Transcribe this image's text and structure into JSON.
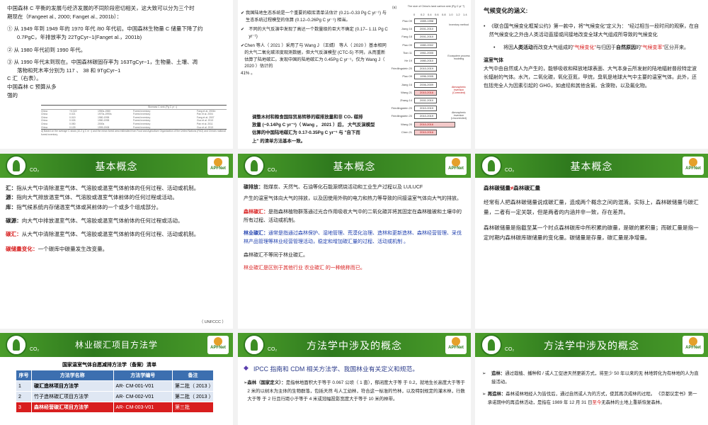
{
  "slide1": {
    "lines": [
      "中国森林 C 平衡的发展与经济发展的不同阶段密切相关，这大致可以分为三个时",
      "期现在（Fangeet al., 2000; Fanget al., 2001b）：",
      "①  从 1949 年到 1949 年的 1970 年代 /80 年代初。中国森林生物量 C 储量下降了约",
      "0.7PgC，年排放率为 22TgCyr−1(Fanget al.，2001b)",
      "②  从 1980 年代初到 1990 年代。",
      "③  从 1990 年代末到现在。中国森林碳固存率为 163TgCyr−1，生物量、土壤、凋",
      "落物和死木率分别为 117 、 38 和 9TgCyr−1",
      "C 汇（右表）。",
      "中国森林 C 预算从多",
      "强的"
    ],
    "table_header": "Biomass C sink (Pg C yr⁻¹)",
    "table_rows": [
      [
        "China",
        "+0.022",
        "1950s-1980",
        "Forest inventory",
        "Fang et al. 2001b"
      ],
      [
        "China",
        "0.021",
        "1970s-1990s",
        "Forest inventory",
        "Pan et al. 2004"
      ],
      [
        "China",
        "0.019",
        "1980-1998",
        "Forest inventory",
        "Fang et al. 2007"
      ],
      [
        "China",
        "0.026",
        "1980-1998",
        "Forest inventory",
        "Guo et al. 2013"
      ],
      [
        "China",
        "0.050",
        "2000s",
        "Forest inventory",
        "Pan et al. 2011"
      ],
      [
        "China",
        "0.109",
        "1999-2008",
        "Forest inventory",
        "Guo et al. 2013"
      ]
    ],
    "table_note": "a) Based on the average C stock (10.2 g C m⁻²) and the mean forest area estimated from Food and Agriculture Organization of the United Nations (FAO) and China's national forest inventory."
  },
  "slide2": {
    "items": [
      "我国陆地生态系统是一个重要的碳库清单法估计 (0.21–0.33 Pg C yr⁻¹) 与生态系统过程模型的估算 (0.12–0.26Pg C yr⁻¹) 相当。",
      "不同的大气反演中发现了高达一个数量级的巨大不确定 (0.17– 1.11 Pg C yr⁻¹)",
      "Chen 等人（ 2021 ）采用了与 Wang J （王婧） 等人（ 2020 ）基本相同的大气二氧化碳浓度观测数据，但大气反演模型 (CTC-5) 不同，从而重新估算了陆地碳汇。发现中国的陆地碳汇为 0.45Pg C yr⁻¹，仅为 Wang J（ 2020 ）估计的",
      "41% 。"
    ],
    "bottom_lines": [
      "调整木材和粮食国际贸易转移的碳排放量和非 CO₂ 碳排",
      "放量 (~0.14Pg C yr⁻¹)（ Wang ， 2021 ）后， 大气反演模型",
      "估算的中国陆地碳汇为 0.17-0.35Pg C yr⁻¹ 与 \"自下而",
      "上\" 的清单方法基本一致。"
    ],
    "chart_label": "(a)",
    "chart_title": "The size of China's land carbon sink (Pg C yr⁻¹)",
    "chart_ticks": [
      "0",
      "0.2",
      "0.4",
      "0.6",
      "0.8",
      "1.0",
      "1.2",
      "1.4"
    ],
    "chart_groups": [
      "Inventory method",
      "Ecosystem process modeling",
      "Atmospheric inversion (Corrected)",
      "Atmospheric inversion (Uncorrected)"
    ],
    "chart_bars": [
      {
        "name": "Piao 09",
        "period": "1989-1998"
      },
      {
        "name": "Jiang 16",
        "period": "2001-2010"
      },
      {
        "name": "Fang 18",
        "period": "2001-2010"
      },
      {
        "name": "Piao 09",
        "period": "1980-2002"
      },
      {
        "name": "Tian 11",
        "period": "1961-2005"
      },
      {
        "name": "He 19",
        "period": "1980-2010"
      },
      {
        "name": "Friedlingstein 20",
        "period": "2010-2019"
      },
      {
        "name": "Piao 09",
        "period": "1996-2005"
      },
      {
        "name": "Jiang 16",
        "period": "2006-2009"
      },
      {
        "name": "Wang 21",
        "period": "2010-2016"
      },
      {
        "name": "Zhang 14",
        "period": "2001-2010"
      },
      {
        "name": "Friedlingstein 20",
        "period": "2010-2019"
      },
      {
        "name": "Friedlingstein 20",
        "period": "2010-2019"
      },
      {
        "name": "Wang 20",
        "period": "2010-2016"
      },
      {
        "name": "Chen 21",
        "period": "2010-2016"
      }
    ]
  },
  "slide3": {
    "heading": "气候变化的涵义:",
    "p1": "《联合国气候变化框架公约》第一款中，将\"气候变化\"定义为：    \"经过相当一段时间的观察，在自然气候变化之外由人类活动直接或间接地改变全球大气组成所导致的气候变化",
    "p2_a": "将因",
    "p2_b": "人类活动",
    "p2_c": "而改变大气组成的",
    "p2_d": "\"气候变化\"",
    "p2_e": "与归因于",
    "p2_f": "自然原因",
    "p2_g": "的",
    "p2_h": "\"气候变率\"",
    "p2_i": "区分开来。",
    "sub_heading": "温室气体",
    "p3": "大气中由自然或人为产生的，能够吸收和释放地球表面、大气本身云所发射的陆地辐射普段特定波长辐射的气体。水汽，二氧化碳，氧化亚氮，甲烷，臭氧是地球大气中主要的温室气体。此外，还包括完全人为因素引起的 GHG，如卤烃和其他含氯、含溴物，以及氟化物。"
  },
  "banner_concept": "基本概念",
  "banner_method": "林业碳汇项目方法学",
  "banner_concepts2": "方法学中涉及的概念",
  "co2": "CO₂",
  "apfnet": "APFNet",
  "slide4": {
    "l1a": "汇：",
    "l1b": "指从大气中清除温室气体、气溶胶或温室气体前体的任何过程、活动或机制。",
    "l2a": "源：",
    "l2b": "指向大气排放温室气体、气溶胶或温室气体前体的任何过程或活动。",
    "l3a": "库：",
    "l3b": "指气候系统内存储温室气体或其前体的一个或多个组成部分。",
    "l4a": "碳源：",
    "l4b": "向大气中排放温室气体、气溶胶或温室气体前体的任何过程或活动。",
    "l5a": "碳汇：",
    "l5b": "从大气中清除温室气体、气溶胶或温室气体前体的任何过程、活动或机制。",
    "l6a": "碳储量变化：",
    "l6b": "一个碳库中碳量发生改变量。",
    "footer": "（ UNFCCC ）"
  },
  "slide5": {
    "l1a": "碳排放：",
    "l1b": "指煤炭、天然气、石油等化石能源燃烧活动和工业生产过程以及 LULUCF",
    "l2": "产生的温室气体向大气的排放，以及因使用外购的电力和热力等导致的间接温室气体向大气的排放。",
    "l3a": "森林碳汇：",
    "l3b": "是指森林植物群落通过光合作用吸收大气中的二氧化碳并将其固定在森林植被和土壤中的所有过程、活动或机制。",
    "l4a": "林业碳汇：",
    "l4b": "通常是指通过森林保护、湿地管理、荒漠化治理、造林和更新造林、森林经营管理、采伐林产品管理等林业经营管理活动，稳定和增加碳汇量的过程、活动或机制 。",
    "l5": "森林碳汇不等同于林业碳汇。",
    "l6": "林业碳汇是区别于其他行业 农业碳汇 的一种统称而已。"
  },
  "slide6": {
    "h_a": "森林碳储量",
    "h_b": "≠",
    "h_c": "森林碳汇量",
    "p1": "经常有人把森林碳储量说成碳汇量，造成两个概念之间的混淆。实际上，森林碳储量与碳汇量，二者有一定关联，但是两者的内涵并非一致，存在差异。",
    "p2": "森林碳储量是指截至某一个时点森林碳库中所积累的碳量，是碳的累积量；而碳汇量是指一定时期内森林碳库碳储量的变化量。碳储量是存量，碳汇量是净增量。"
  },
  "slide7": {
    "caption": "国家温室气体自愿减排方法学（备案）清单",
    "headers": [
      "序号",
      "方法学名称",
      "方法学编号",
      "备注"
    ],
    "rows": [
      [
        "1",
        "碳汇造林项目方法学",
        "AR- CM-001-V01",
        "第二批（ 2013 ）"
      ],
      [
        "2",
        "竹子造林碳汇项目方法学",
        "AR- CM-002-V01",
        "第二批（ 2013 ）"
      ],
      [
        "3",
        "森林经营碳汇项目方法学",
        "AR- CM-003-V01",
        "第三批"
      ]
    ]
  },
  "slide8": {
    "heading": "IPCC 指南和 CDM 相关方法学、我国林业有关定义和规范。",
    "p1a": "森林（国家定义）：",
    "p1b": "是指林地面积大于等于 0.067 公顷（ 1 亩），郁闭度大于等 于 0.2，就地生长高度大于等于 2 米的以树木为主体的生物群落，包括天然 与人工幼林，符合这一标准的竹林，以及特别规定的灌木林，行数大于等 于 2 行且行距小于等于 4 米或冠幅投影宽度大于等于 10 米的林带。"
  },
  "slide9": {
    "p1a": "造林：",
    "p1b": "通过栽植、播种和 / 或人工促进天然更新方式，将至少 50 年以来的无 林地转化为有林地的人为直接活动。",
    "p2a": "再造林：",
    "p2b": "森林或林地经人为皆伐后，通过自然或人为的方式，使其再次成林的过程。 《京都议定书》第一承诺期中的再造林活动，是指在 1989 年 12 月 31 日",
    "p2c": "至今",
    "p2d": "无森林的土地上重新恢复森林。"
  }
}
